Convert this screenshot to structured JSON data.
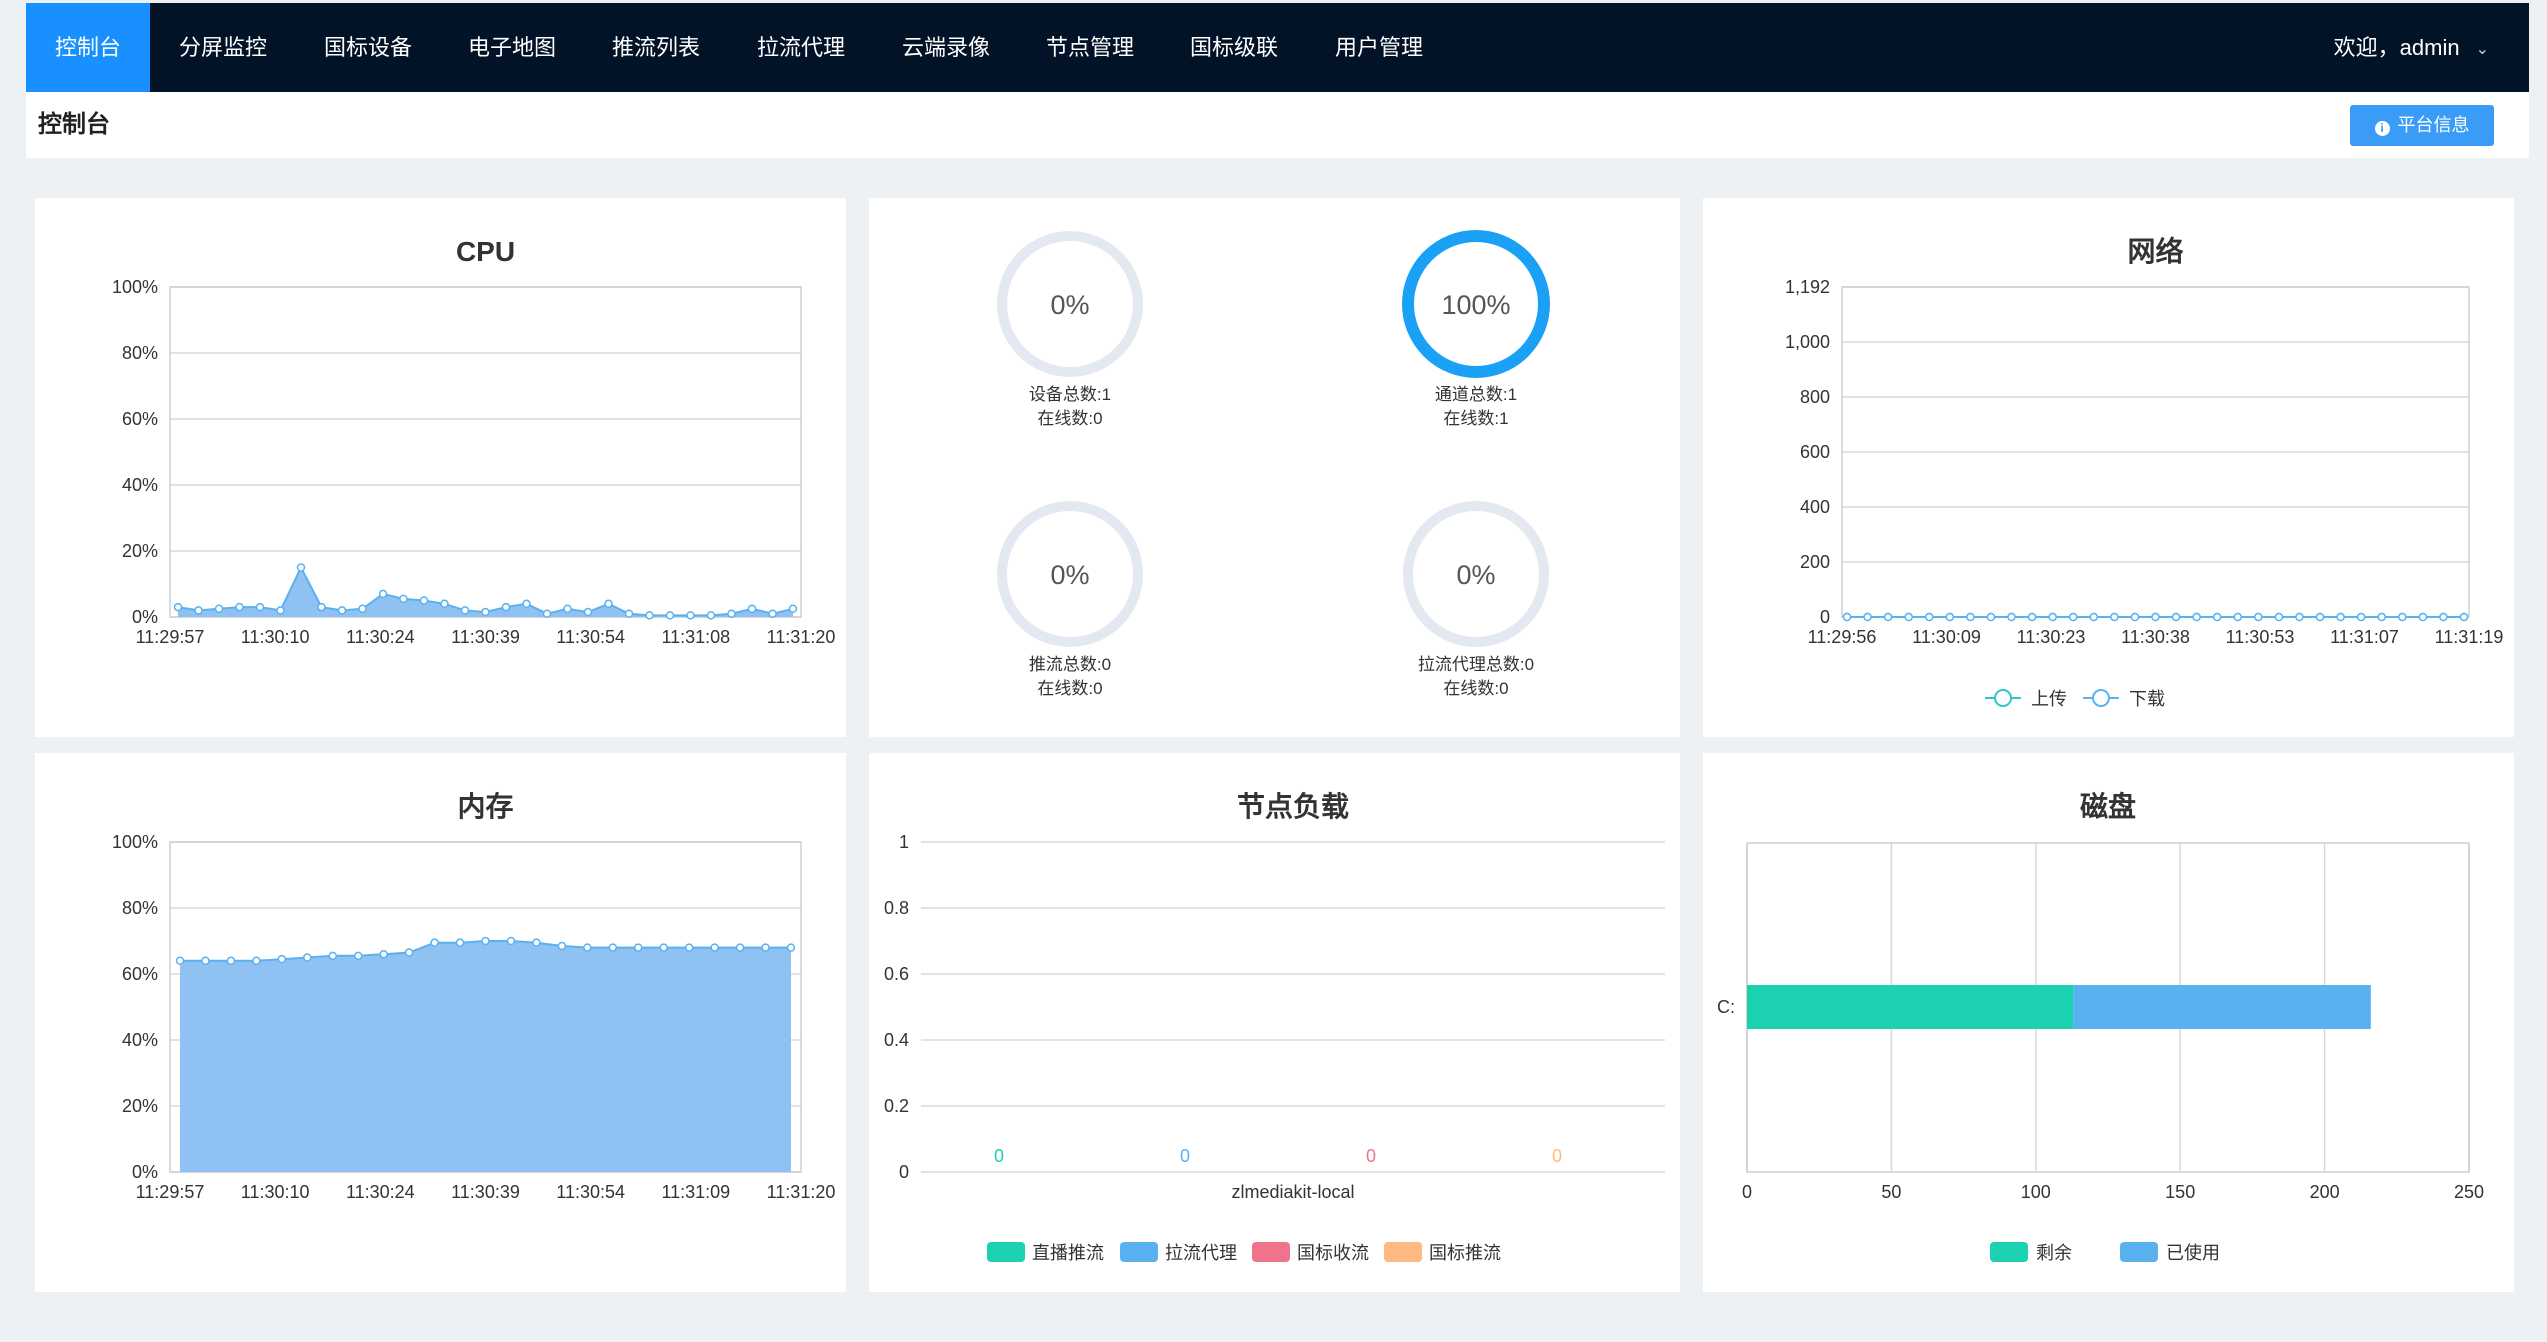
{
  "nav": {
    "items": [
      "控制台",
      "分屏监控",
      "国标设备",
      "电子地图",
      "推流列表",
      "拉流代理",
      "云端录像",
      "节点管理",
      "国标级联",
      "用户管理"
    ],
    "welcome": "欢迎，admin"
  },
  "header": {
    "title": "控制台",
    "info_button": "平台信息"
  },
  "cpu": {
    "chart_data": {
      "type": "area",
      "title": "CPU",
      "x_ticks": [
        "11:29:57",
        "11:30:10",
        "11:30:24",
        "11:30:39",
        "11:30:54",
        "11:31:08",
        "11:31:20"
      ],
      "y_ticks": [
        "100%",
        "80%",
        "60%",
        "40%",
        "20%",
        "0%"
      ],
      "ylim": [
        0,
        100
      ],
      "values": [
        3,
        2,
        2.5,
        3,
        3,
        2,
        15,
        3,
        2,
        2.5,
        7,
        5.5,
        5,
        4,
        2,
        1.5,
        3,
        4,
        1,
        2.5,
        1.5,
        4,
        1,
        0.5,
        0.5,
        0.5,
        0.5,
        1,
        2.5,
        1,
        2.5
      ]
    }
  },
  "status": {
    "gauges": [
      {
        "percent": "0%",
        "line1": "设备总数:1",
        "line2": "在线数:0",
        "value": 0
      },
      {
        "percent": "100%",
        "line1": "通道总数:1",
        "line2": "在线数:1",
        "value": 1
      },
      {
        "percent": "0%",
        "line1": "推流总数:0",
        "line2": "在线数:0",
        "value": 0
      },
      {
        "percent": "0%",
        "line1": "拉流代理总数:0",
        "line2": "在线数:0",
        "value": 0
      }
    ]
  },
  "network": {
    "chart_data": {
      "type": "line",
      "title": "网络",
      "x_ticks": [
        "11:29:56",
        "11:30:09",
        "11:30:23",
        "11:30:38",
        "11:30:53",
        "11:31:07",
        "11:31:19"
      ],
      "y_ticks": [
        "1,192",
        "1,000",
        "800",
        "600",
        "400",
        "200",
        "0"
      ],
      "ylim": [
        0,
        1192
      ],
      "series": [
        {
          "name": "上传",
          "values": [
            0,
            0,
            0,
            0,
            0,
            0,
            0,
            0,
            0,
            0,
            0,
            0,
            0,
            0,
            0,
            0,
            0,
            0,
            0,
            0,
            0,
            0,
            0,
            0,
            0,
            0,
            0,
            0,
            0,
            0,
            0
          ]
        },
        {
          "name": "下载",
          "values": [
            0,
            0,
            0,
            0,
            0,
            0,
            0,
            0,
            0,
            0,
            0,
            0,
            0,
            0,
            0,
            0,
            0,
            0,
            0,
            0,
            0,
            0,
            0,
            0,
            0,
            0,
            0,
            0,
            0,
            0,
            0
          ]
        }
      ],
      "colors": [
        "#2ec7c9",
        "#5ab1ef"
      ]
    }
  },
  "memory": {
    "chart_data": {
      "type": "area",
      "title": "内存",
      "x_ticks": [
        "11:29:57",
        "11:30:10",
        "11:30:24",
        "11:30:39",
        "11:30:54",
        "11:31:09",
        "11:31:20"
      ],
      "y_ticks": [
        "100%",
        "80%",
        "60%",
        "40%",
        "20%",
        "0%"
      ],
      "ylim": [
        0,
        100
      ],
      "values": [
        64,
        64,
        64,
        64,
        64.5,
        65,
        65.5,
        65.5,
        66,
        66.5,
        69.5,
        69.5,
        70,
        70,
        69.5,
        68.5,
        68,
        68,
        68,
        68,
        68,
        68,
        68,
        68,
        68
      ]
    }
  },
  "nodeload": {
    "chart_data": {
      "type": "bar",
      "title": "节点负载",
      "categories": [
        "zlmediakit-local"
      ],
      "y_ticks": [
        "1",
        "0.8",
        "0.6",
        "0.4",
        "0.2",
        "0"
      ],
      "ylim": [
        0,
        1
      ],
      "series": [
        {
          "name": "直播推流",
          "values": [
            0
          ],
          "label": "0"
        },
        {
          "name": "拉流代理",
          "values": [
            0
          ],
          "label": "0"
        },
        {
          "name": "国标收流",
          "values": [
            0
          ],
          "label": "0"
        },
        {
          "name": "国标推流",
          "values": [
            0
          ],
          "label": "0"
        }
      ],
      "colors": [
        "#1bd1b0",
        "#5ab1ef",
        "#f0738c",
        "#ffb980"
      ]
    }
  },
  "disk": {
    "chart_data": {
      "type": "bar",
      "orientation": "horizontal-stacked",
      "title": "磁盘",
      "categories": [
        "C:"
      ],
      "x_ticks": [
        "0",
        "50",
        "100",
        "150",
        "200",
        "250"
      ],
      "xlim": [
        0,
        250
      ],
      "series": [
        {
          "name": "剩余",
          "values": [
            113
          ]
        },
        {
          "name": "已使用",
          "values": [
            103
          ]
        }
      ],
      "colors": [
        "#1bd1b0",
        "#5ab1ef"
      ]
    }
  }
}
